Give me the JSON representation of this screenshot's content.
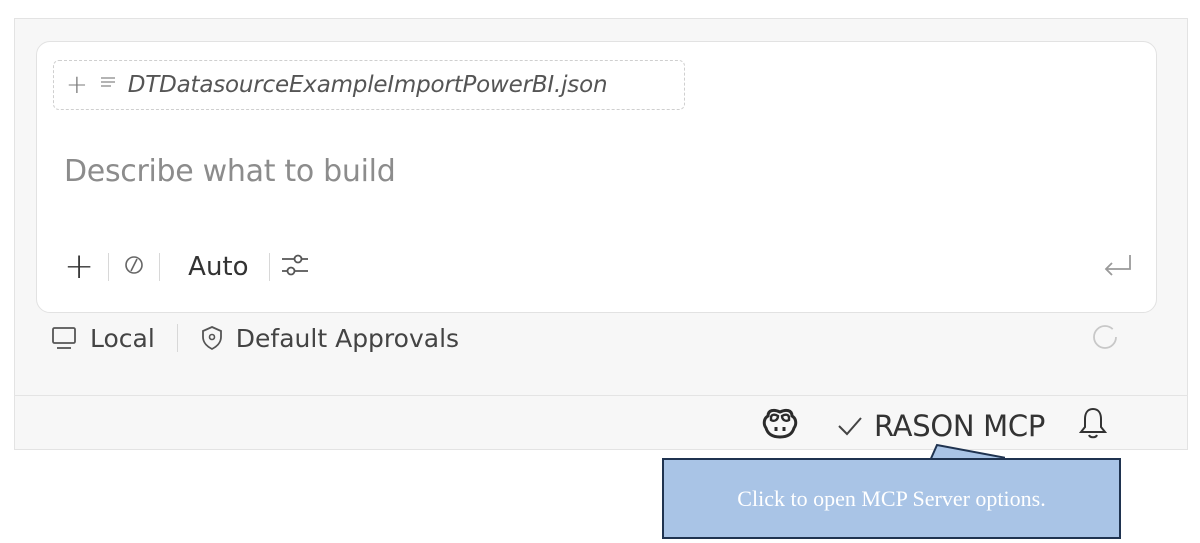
{
  "attachment": {
    "add_label": "+",
    "filename": "DTDatasourceExampleImportPowerBI.json"
  },
  "input": {
    "placeholder": "Describe what to build"
  },
  "toolbar": {
    "add_label": "+",
    "mode_label": "Auto"
  },
  "footer": {
    "location_label": "Local",
    "approvals_label": "Default Approvals"
  },
  "statusbar": {
    "mcp_label": "RASON MCP"
  },
  "callout": {
    "text": "Click to open MCP Server options.",
    "fill_color": "#a9c4e6",
    "border_color": "#1f3350"
  },
  "icons": {
    "attachment": [
      "plus-icon",
      "file-lines-icon"
    ],
    "toolbar": [
      "plus-icon",
      "tools-icon",
      "settings-sliders-icon",
      "enter-icon"
    ],
    "footer": [
      "monitor-icon",
      "shield-icon",
      "spinner-icon"
    ],
    "statusbar": [
      "copilot-icon",
      "check-icon",
      "bell-icon"
    ]
  }
}
